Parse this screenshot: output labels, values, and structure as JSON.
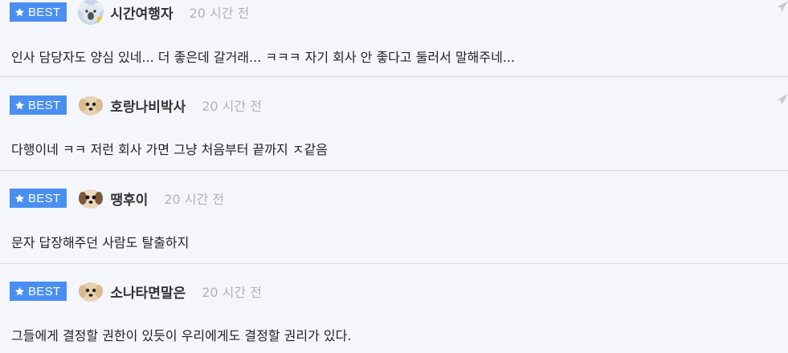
{
  "badge_label": "BEST",
  "colors": {
    "badge": "#4a8ef2",
    "background": "#f4f6fc",
    "time": "#b2b2b2",
    "divider": "#d7dbe6"
  },
  "comments": [
    {
      "nickname": "시간여행자",
      "time": "20 시간 전",
      "text": "인사 담당자도 양심 있네... 더 좋은데 갈거래... ㅋㅋㅋ 자기 회사 안 좋다고 둘러서 말해주네...",
      "avatar_icon": "koala-avatar-icon"
    },
    {
      "nickname": "호랑나비박사",
      "time": "20 시간 전",
      "text": "다행이네 ㅋㅋ 저런 회사 가면 그냥 처음부터 끝까지 ㅈ같음",
      "avatar_icon": "puppy-avatar-icon"
    },
    {
      "nickname": "땡후이",
      "time": "20 시간 전",
      "text": "문자 답장해주던 사람도 탈출하지",
      "avatar_icon": "puppy-avatar-icon"
    },
    {
      "nickname": "소나타면말은",
      "time": "20 시간 전",
      "text": "그들에게 결정할 권한이 있듯이 우리에게도 결정할 권리가 있다.",
      "avatar_icon": "puppy-avatar-icon"
    }
  ]
}
